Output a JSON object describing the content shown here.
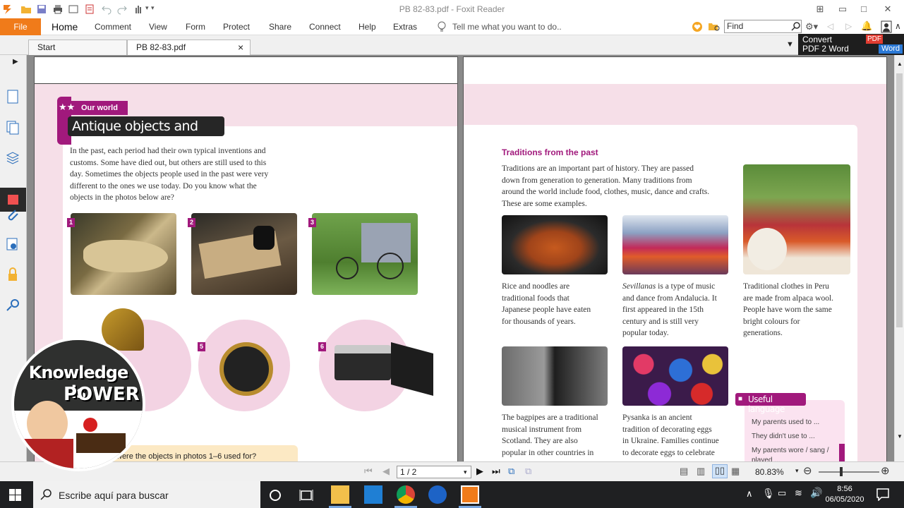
{
  "app": {
    "title": "PB 82-83.pdf - Foxit Reader",
    "file_label": "File",
    "menu": [
      "Home",
      "Comment",
      "View",
      "Form",
      "Protect",
      "Share",
      "Connect",
      "Help",
      "Extras"
    ],
    "tell_me": "Tell me what you want to do..",
    "find_placeholder": "Find",
    "tabs": [
      {
        "label": "Start"
      },
      {
        "label": "PB 82-83.pdf",
        "close": "×"
      }
    ],
    "convert": {
      "line1": "Convert",
      "line2": "PDF 2 Word",
      "badge_pdf": "PDF",
      "badge_word": "Word"
    }
  },
  "left_page": {
    "section_tag": "Our world",
    "title": "Antique objects and traditions",
    "intro": [
      "In the past, each period had their own typical inventions and",
      "customs. Some have died out, but others are still used to this",
      "day. Sometimes the objects people used in the past were very",
      "different to the ones we use today. Do you know what the",
      "objects in the photos below are?"
    ],
    "photo_numbers": [
      "1",
      "2",
      "3",
      "5",
      "6"
    ],
    "question": "were the objects in photos 1–6 used for?"
  },
  "right_page": {
    "heading": "Traditions from the past",
    "intro": [
      "Traditions are an important part of history. They are passed",
      "down from generation to generation. Many traditions from",
      "around the world include food, clothes, music, dance and crafts.",
      "These are some examples."
    ],
    "captions": {
      "rice": [
        "Rice and noodles are",
        "traditional foods that",
        "Japanese people have eaten",
        "for thousands of years."
      ],
      "sevillanas_italic": "Sevillanas",
      "sevillanas": [
        " is a type of music",
        "and dance from Andalucia. It",
        "first appeared in the 15th",
        "century and is still very",
        "popular today."
      ],
      "peru": [
        "Traditional clothes in Peru",
        "are made from alpaca wool.",
        "People have worn the same",
        "bright colours for",
        "generations."
      ],
      "bagpipes": [
        "The bagpipes are a traditional",
        "musical instrument from",
        "Scotland. They are also",
        "popular in other countries in"
      ],
      "pysanka": [
        "Pysanka is an ancient",
        "tradition of decorating eggs",
        "in Ukraine. Families continue",
        "to decorate eggs to celebrate"
      ]
    },
    "useful_language": {
      "title": "Useful language",
      "items": [
        "My parents used to ...",
        "They didn't use to ...",
        "My parents wore / sang /",
        "played ..."
      ]
    }
  },
  "status": {
    "page": "1 / 2",
    "zoom": "80.83%"
  },
  "taskbar": {
    "search_placeholder": "Escribe aquí para buscar",
    "time": "8:56",
    "date": "06/05/2020"
  },
  "overlay": {
    "line1": "Knowledge is",
    "line2": "POWER"
  },
  "colors": {
    "accent": "#f07b1a",
    "magenta": "#a1197c",
    "pink_bg": "#f6dfe8"
  }
}
